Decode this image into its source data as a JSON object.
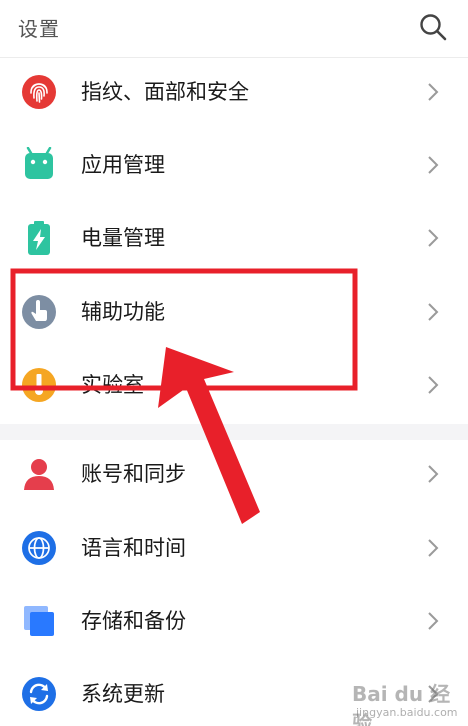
{
  "header": {
    "title": "设置",
    "search_icon": "search-icon"
  },
  "settings": {
    "items": [
      {
        "label": "指纹、面部和安全",
        "icon": "fingerprint-icon",
        "color": "#e53935"
      },
      {
        "label": "应用管理",
        "icon": "android-icon",
        "color": "#2ec4a0"
      },
      {
        "label": "电量管理",
        "icon": "battery-icon",
        "color": "#2ec4a0"
      },
      {
        "label": "辅助功能",
        "icon": "hand-pointer-icon",
        "color": "#7d8ea3"
      },
      {
        "label": "实验室",
        "icon": "lab-icon",
        "color": "#f5a623"
      },
      {
        "label": "账号和同步",
        "icon": "person-icon",
        "color": "#e53e4c"
      },
      {
        "label": "语言和时间",
        "icon": "globe-icon",
        "color": "#1e6fe6"
      },
      {
        "label": "存储和备份",
        "icon": "storage-icon",
        "color": "#2979ff"
      },
      {
        "label": "系统更新",
        "icon": "sync-icon",
        "color": "#1e6fe6"
      }
    ]
  },
  "annotation": {
    "highlight_color": "#e8202a",
    "arrow_color": "#e8202a"
  },
  "watermark": {
    "text": "Bai du 经验",
    "sub": "jingyan.baidu.com"
  }
}
